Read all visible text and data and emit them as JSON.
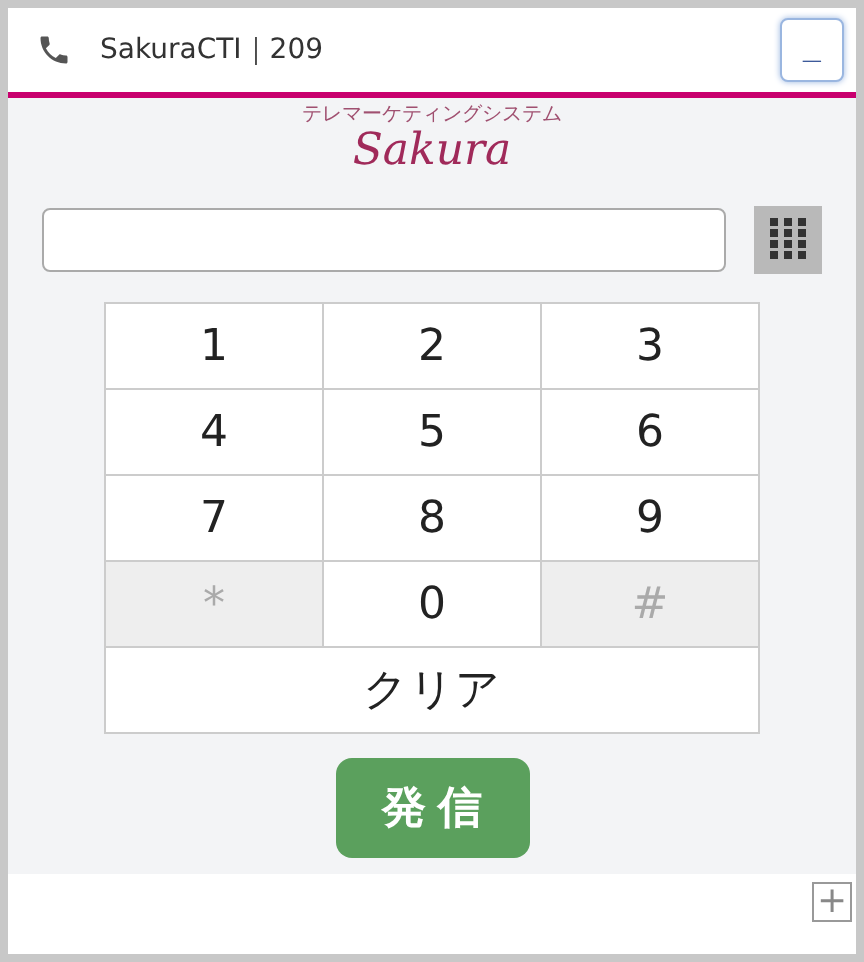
{
  "header": {
    "title": "SakuraCTI｜209",
    "minimize": "_"
  },
  "logo": {
    "tagline": "テレマーケティングシステム",
    "name": "Sakura"
  },
  "keypad": {
    "keys": [
      {
        "label": "1",
        "disabled": false
      },
      {
        "label": "2",
        "disabled": false
      },
      {
        "label": "3",
        "disabled": false
      },
      {
        "label": "4",
        "disabled": false
      },
      {
        "label": "5",
        "disabled": false
      },
      {
        "label": "6",
        "disabled": false
      },
      {
        "label": "7",
        "disabled": false
      },
      {
        "label": "8",
        "disabled": false
      },
      {
        "label": "9",
        "disabled": false
      },
      {
        "label": "*",
        "disabled": true
      },
      {
        "label": "0",
        "disabled": false
      },
      {
        "label": "#",
        "disabled": true
      }
    ],
    "clear": "クリア"
  },
  "call_button": "発 信",
  "footer": {
    "expand": "+"
  }
}
